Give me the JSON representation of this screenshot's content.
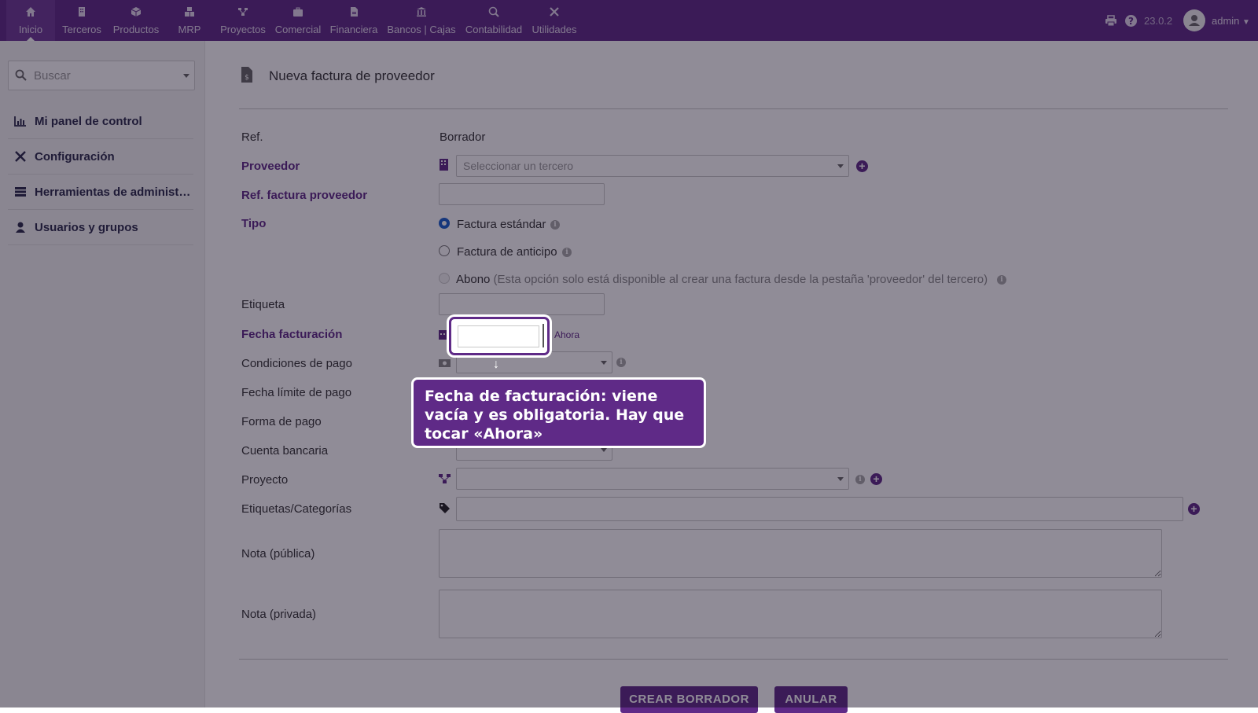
{
  "topbar": {
    "menu": [
      {
        "label": "Inicio",
        "icon": "home-icon"
      },
      {
        "label": "Terceros",
        "icon": "building-icon"
      },
      {
        "label": "Productos",
        "icon": "cube-icon"
      },
      {
        "label": "MRP",
        "icon": "cubes-icon"
      },
      {
        "label": "Proyectos",
        "icon": "project-icon"
      },
      {
        "label": "Comercial",
        "icon": "briefcase-icon"
      },
      {
        "label": "Financiera",
        "icon": "file-invoice-icon"
      },
      {
        "label": "Bancos | Cajas",
        "icon": "bank-icon"
      },
      {
        "label": "Contabilidad",
        "icon": "search-dollar-icon"
      },
      {
        "label": "Utilidades",
        "icon": "tools-icon"
      }
    ],
    "version": "23.0.2",
    "user": "admin"
  },
  "sidebar": {
    "search_placeholder": "Buscar",
    "items": [
      {
        "label": "Mi panel de control",
        "icon": "chart-icon"
      },
      {
        "label": "Configuración",
        "icon": "tools-icon"
      },
      {
        "label": "Herramientas de administración",
        "icon": "server-icon"
      },
      {
        "label": "Usuarios y grupos",
        "icon": "user-icon"
      }
    ]
  },
  "main": {
    "title": "Nueva factura de proveedor",
    "fields": {
      "ref_label": "Ref.",
      "ref_value": "Borrador",
      "supplier_label": "Proveedor",
      "supplier_placeholder": "Seleccionar un tercero",
      "supplier_ref_label": "Ref. factura proveedor",
      "type_label": "Tipo",
      "type_standard": "Factura estándar",
      "type_deposit": "Factura de anticipo",
      "type_credit": "Abono",
      "type_credit_hint": "(Esta opción solo está disponible al crear una factura desde la pestaña 'proveedor' del tercero)",
      "label_label": "Etiqueta",
      "invoice_date_label": "Fecha facturación",
      "now_link": "Ahora",
      "payment_terms_label": "Condiciones de pago",
      "due_date_label": "Fecha límite de pago",
      "payment_mode_label": "Forma de pago",
      "bank_account_label": "Cuenta bancaria",
      "project_label": "Proyecto",
      "tags_label": "Etiquetas/Categorías",
      "note_public_label": "Nota (pública)",
      "note_private_label": "Nota (privada)"
    },
    "buttons": {
      "create": "CREAR BORRADOR",
      "cancel": "ANULAR"
    }
  },
  "tooltip": {
    "text": "Fecha de facturación: viene vacía y es obligatoria. Hay que tocar «Ahora»"
  },
  "colors": {
    "brand": "#5f2a87",
    "overlay": "rgba(20,10,35,0.47)"
  }
}
